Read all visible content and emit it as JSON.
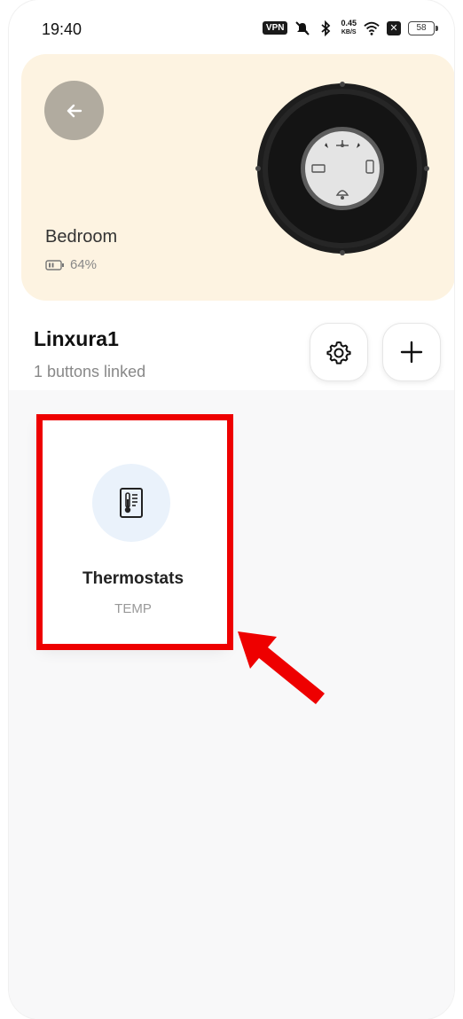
{
  "status_bar": {
    "time": "19:40",
    "vpn": "VPN",
    "net_speed_value": "0.45",
    "net_speed_unit": "KB/S",
    "battery": "58"
  },
  "hero": {
    "device_name": "Bedroom",
    "battery_percent": "64%",
    "background_color": "#fdf3e1"
  },
  "header": {
    "title": "Linxura1",
    "subtitle": "1 buttons linked"
  },
  "linked_buttons": [
    {
      "name": "Thermostats",
      "type": "TEMP",
      "icon": "thermometer-icon"
    }
  ],
  "annotation": {
    "color": "#ee0000"
  }
}
